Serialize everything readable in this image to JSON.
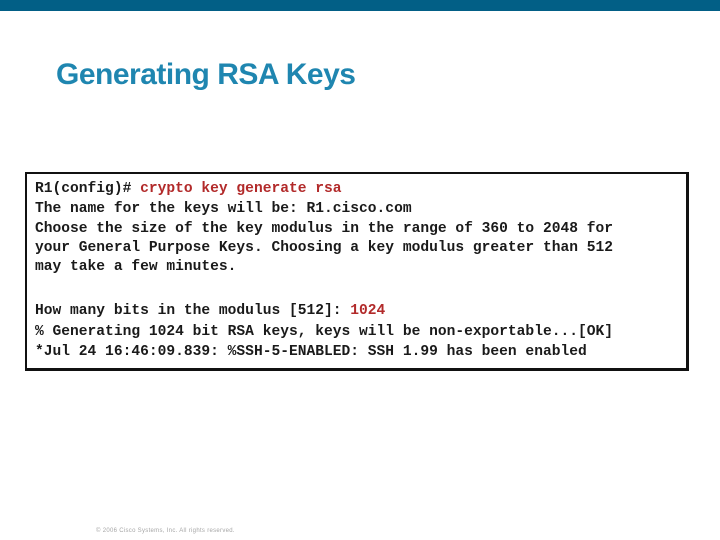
{
  "slide": {
    "title": "Generating RSA Keys",
    "footer": "© 2006 Cisco Systems, Inc. All rights reserved."
  },
  "colors": {
    "topbar": "#025f86",
    "title": "#1f86b0",
    "command": "#b22a2a",
    "text": "#1a1a1a"
  },
  "terminal": {
    "lines": [
      {
        "prefix": "R1(config)# ",
        "command": "crypto key generate rsa"
      },
      {
        "text": "The name for the keys will be: R1.cisco.com"
      },
      {
        "text": "Choose the size of the key modulus in the range of 360 to 2048 for"
      },
      {
        "text": "your General Purpose Keys. Choosing a key modulus greater than 512"
      },
      {
        "text": "may take a few minutes."
      },
      {
        "prefix": "How many bits in the modulus [512]: ",
        "command": "1024"
      },
      {
        "text": "% Generating 1024 bit RSA keys, keys will be non-exportable...[OK]"
      },
      {
        "text": "*Jul 24 16:46:09.839: %SSH-5-ENABLED: SSH 1.99 has been enabled"
      }
    ]
  }
}
